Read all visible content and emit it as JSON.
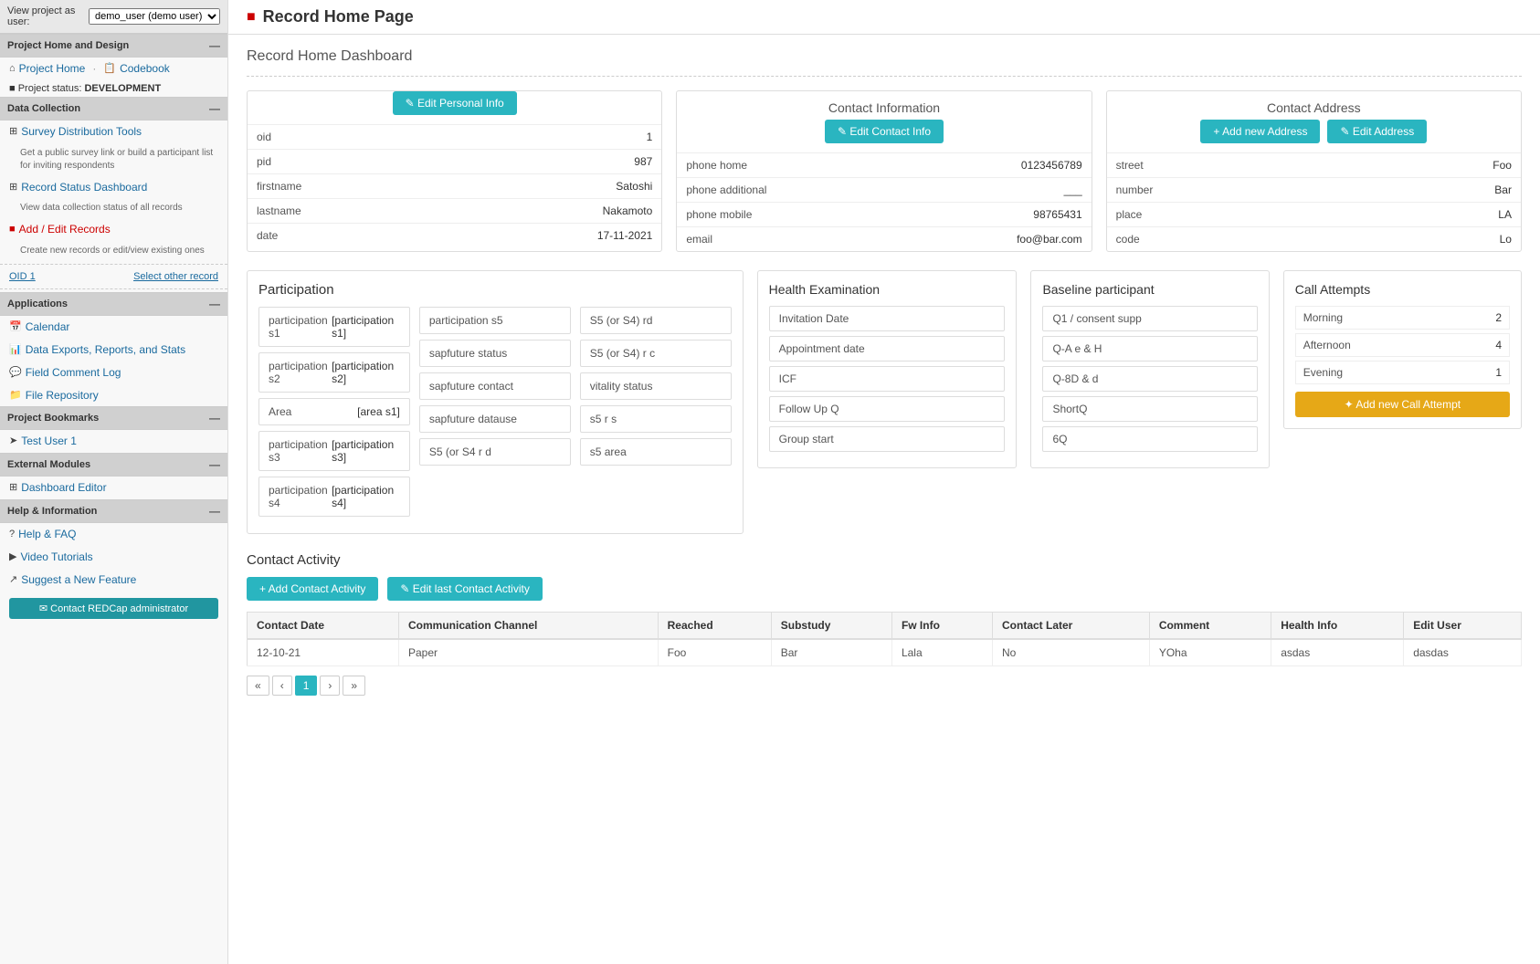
{
  "topBar": {
    "viewAs": "View project as user:",
    "userOption": "demo_user (demo user)"
  },
  "sidebar": {
    "sections": [
      {
        "id": "project-home-design",
        "label": "Project Home and Design",
        "items": [
          {
            "id": "project-home",
            "label": "Project Home",
            "icon": "⌂",
            "type": "link"
          },
          {
            "id": "codebook",
            "label": "Codebook",
            "icon": "📋",
            "type": "link",
            "inline": true
          },
          {
            "id": "project-status",
            "label": "Project status:",
            "value": "DEVELOPMENT",
            "type": "status"
          }
        ]
      },
      {
        "id": "data-collection",
        "label": "Data Collection",
        "items": [
          {
            "id": "survey-dist",
            "label": "Survey Distribution Tools",
            "icon": "⊞",
            "type": "link"
          },
          {
            "id": "survey-desc",
            "label": "Get a public survey link or build a participant list for inviting respondents",
            "type": "desc"
          },
          {
            "id": "record-status",
            "label": "Record Status Dashboard",
            "icon": "⊞",
            "type": "link"
          },
          {
            "id": "record-status-desc",
            "label": "View data collection status of all records",
            "type": "desc"
          },
          {
            "id": "add-edit",
            "label": "Add / Edit Records",
            "icon": "■",
            "type": "link-red",
            "active": true
          },
          {
            "id": "add-edit-desc",
            "label": "Create new records or edit/view existing ones",
            "type": "desc"
          }
        ]
      },
      {
        "id": "oid-section",
        "oid": "OID 1",
        "selectOther": "Select other record"
      },
      {
        "id": "applications",
        "label": "Applications",
        "items": [
          {
            "id": "calendar",
            "label": "Calendar",
            "icon": "📅",
            "type": "link"
          },
          {
            "id": "data-exports",
            "label": "Data Exports, Reports, and Stats",
            "icon": "📊",
            "type": "link"
          },
          {
            "id": "field-comment",
            "label": "Field Comment Log",
            "icon": "💬",
            "type": "link"
          },
          {
            "id": "file-repo",
            "label": "File Repository",
            "icon": "📁",
            "type": "link"
          }
        ]
      },
      {
        "id": "project-bookmarks",
        "label": "Project Bookmarks",
        "items": [
          {
            "id": "test-user",
            "label": "Test User 1",
            "icon": "➤",
            "type": "link"
          }
        ]
      },
      {
        "id": "external-modules",
        "label": "External Modules",
        "items": [
          {
            "id": "dashboard-editor",
            "label": "Dashboard Editor",
            "icon": "⊞",
            "type": "link"
          }
        ]
      },
      {
        "id": "help-info",
        "label": "Help & Information",
        "items": [
          {
            "id": "help-faq",
            "label": "Help & FAQ",
            "icon": "?",
            "type": "link"
          },
          {
            "id": "video-tutorials",
            "label": "Video Tutorials",
            "icon": "▶",
            "type": "link"
          },
          {
            "id": "suggest-feature",
            "label": "Suggest a New Feature",
            "icon": "↗",
            "type": "link"
          }
        ]
      }
    ],
    "contactBtn": "✉ Contact REDCap administrator"
  },
  "pageHeader": {
    "icon": "■",
    "title": "Record Home Page"
  },
  "dashboardTitle": "Record Home Dashboard",
  "personalInfo": {
    "sectionTitle": "Edit Personal Info",
    "editBtn": "✎ Edit Personal Info",
    "fields": [
      {
        "label": "oid",
        "value": "1"
      },
      {
        "label": "pid",
        "value": "987"
      },
      {
        "label": "firstname",
        "value": "Satoshi"
      },
      {
        "label": "lastname",
        "value": "Nakamoto"
      },
      {
        "label": "date",
        "value": "17-11-2021"
      }
    ]
  },
  "contactInfo": {
    "sectionTitle": "Contact Information",
    "editBtn": "✎ Edit Contact Info",
    "fields": [
      {
        "label": "phone home",
        "value": "0123456789"
      },
      {
        "label": "phone additional",
        "value": "___"
      },
      {
        "label": "phone mobile",
        "value": "98765431"
      },
      {
        "label": "email",
        "value": "foo@bar.com"
      }
    ]
  },
  "contactAddress": {
    "sectionTitle": "Contact Address",
    "addBtn": "+ Add new Address",
    "editBtn": "✎ Edit Address",
    "fields": [
      {
        "label": "street",
        "value": "Foo"
      },
      {
        "label": "number",
        "value": "Bar"
      },
      {
        "label": "place",
        "value": "LA"
      },
      {
        "label": "code",
        "value": "Lo"
      }
    ]
  },
  "participation": {
    "title": "Participation",
    "col1": [
      {
        "label": "participation s1",
        "value": "[participation s1]"
      },
      {
        "label": "participation s2",
        "value": "[participation s2]"
      },
      {
        "label": "Area",
        "value": "[area s1]"
      },
      {
        "label": "participation s3",
        "value": "[participation s3]"
      },
      {
        "label": "participation s4",
        "value": "[participation s4]"
      }
    ],
    "col2": [
      {
        "label": "participation s5",
        "value": ""
      },
      {
        "label": "sapfuture status",
        "value": ""
      },
      {
        "label": "sapfuture contact",
        "value": ""
      },
      {
        "label": "sapfuture datause",
        "value": ""
      },
      {
        "label": "S5 (or S4 r d",
        "value": ""
      }
    ],
    "col3": [
      {
        "label": "S5 (or S4) rd",
        "value": ""
      },
      {
        "label": "S5 (or S4) r c",
        "value": ""
      },
      {
        "label": "vitality status",
        "value": ""
      },
      {
        "label": "s5 r s",
        "value": ""
      },
      {
        "label": "s5 area",
        "value": ""
      }
    ]
  },
  "healthExam": {
    "title": "Health Examination",
    "items": [
      "Invitation Date",
      "Appointment date",
      "ICF",
      "Follow Up Q",
      "Group start"
    ]
  },
  "baseline": {
    "title": "Baseline participant",
    "items": [
      "Q1 / consent supp",
      "Q-A e & H",
      "Q-8D & d",
      "ShortQ",
      "6Q"
    ]
  },
  "callAttempts": {
    "title": "Call Attempts",
    "rows": [
      {
        "label": "Morning",
        "value": "2"
      },
      {
        "label": "Afternoon",
        "value": "4"
      },
      {
        "label": "Evening",
        "value": "1"
      }
    ],
    "addBtn": "✦ Add new Call Attempt"
  },
  "contactActivity": {
    "title": "Contact Activity",
    "addBtn": "+ Add Contact Activity",
    "editBtn": "✎ Edit last Contact Activity",
    "tableHeaders": [
      "Contact Date",
      "Communication Channel",
      "Reached",
      "Substudy",
      "Fw Info",
      "Contact Later",
      "Comment",
      "Health Info",
      "Edit User"
    ],
    "rows": [
      {
        "contactDate": "12-10-21",
        "commChannel": "Paper",
        "reached": "Foo",
        "substudy": "Bar",
        "fwInfo": "Lala",
        "contactLater": "No",
        "comment": "YOha",
        "healthInfo": "asdas",
        "editUser": "dasdas"
      }
    ],
    "pagination": {
      "first": "«",
      "prev": "‹",
      "current": "1",
      "next": "›",
      "last": "»"
    }
  }
}
